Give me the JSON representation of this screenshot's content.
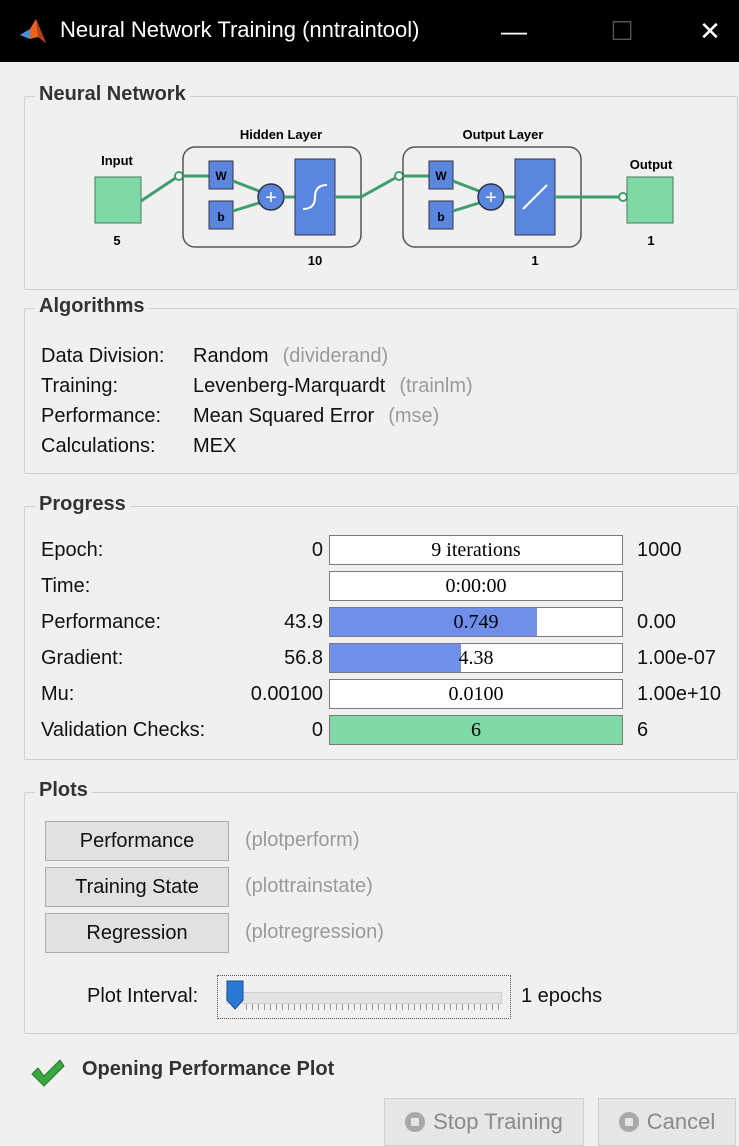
{
  "window": {
    "title": "Neural Network Training (nntraintool)",
    "minimize_glyph": "—",
    "maximize_glyph": "☐",
    "close_glyph": "✕"
  },
  "network": {
    "title": "Neural Network",
    "input_label": "Input",
    "input_size": "5",
    "hidden_title": "Hidden Layer",
    "hidden_size": "10",
    "output_layer_title": "Output Layer",
    "output_layer_size": "1",
    "output_label": "Output",
    "output_size": "1",
    "w_label": "W",
    "b_label": "b"
  },
  "algorithms": {
    "title": "Algorithms",
    "rows": [
      {
        "label": "Data Division:",
        "value": "Random",
        "fn": "(dividerand)"
      },
      {
        "label": "Training:",
        "value": "Levenberg-Marquardt",
        "fn": "(trainlm)"
      },
      {
        "label": "Performance:",
        "value": "Mean Squared Error",
        "fn": "(mse)"
      },
      {
        "label": "Calculations:",
        "value": "MEX",
        "fn": ""
      }
    ]
  },
  "progress": {
    "title": "Progress",
    "rows": [
      {
        "label": "Epoch:",
        "start": "0",
        "current": "9 iterations",
        "end": "1000",
        "fill": 0.0,
        "color": "#6f8fe8"
      },
      {
        "label": "Time:",
        "start": "",
        "current": "0:00:00",
        "end": "",
        "fill": 0.0,
        "color": "#6f8fe8"
      },
      {
        "label": "Performance:",
        "start": "43.9",
        "current": "0.749",
        "end": "0.00",
        "fill": 0.71,
        "color": "#6f8fe8"
      },
      {
        "label": "Gradient:",
        "start": "56.8",
        "current": "4.38",
        "end": "1.00e-07",
        "fill": 0.45,
        "color": "#6f8fe8"
      },
      {
        "label": "Mu:",
        "start": "0.00100",
        "current": "0.0100",
        "end": "1.00e+10",
        "fill": 0.0,
        "color": "#6f8fe8"
      },
      {
        "label": "Validation Checks:",
        "start": "0",
        "current": "6",
        "end": "6",
        "fill": 1.0,
        "color": "#7fd9a6"
      }
    ]
  },
  "plots": {
    "title": "Plots",
    "buttons": [
      {
        "label": "Performance",
        "fn": "(plotperform)"
      },
      {
        "label": "Training State",
        "fn": "(plottrainstate)"
      },
      {
        "label": "Regression",
        "fn": "(plotregression)"
      }
    ],
    "interval_label": "Plot Interval:",
    "interval_value": "1 epochs"
  },
  "status": {
    "text": "Opening Performance Plot",
    "icon": "checkmark-icon"
  },
  "actions": {
    "stop_label": "Stop Training",
    "cancel_label": "Cancel"
  },
  "colors": {
    "input_box": "#7fd9a6",
    "weight_box": "#5b86e0",
    "bar_blue": "#6f8fe8",
    "bar_green": "#7fd9a6",
    "check_green": "#3aa640",
    "logo_orange": "#e8641e"
  }
}
